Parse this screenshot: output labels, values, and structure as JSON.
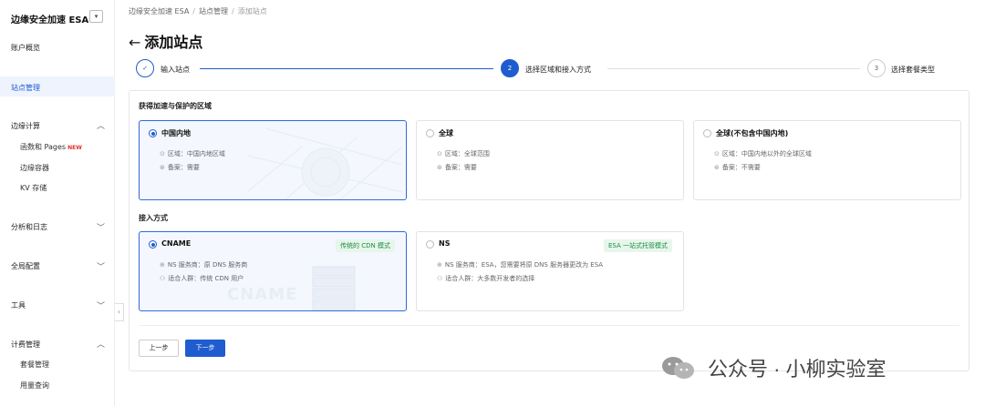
{
  "sidebar": {
    "brand": "边缘安全加速 ESA",
    "brand_toggle": "▾",
    "overview": "账户概览",
    "sites": "站点管理",
    "edge_compute": "边缘计算",
    "functions": "函数和 Pages",
    "new_badge": "NEW",
    "edge_container": "边缘容器",
    "kv": "KV 存储",
    "analytics": "分析和日志",
    "global_config": "全局配置",
    "tools": "工具",
    "billing": "计费管理",
    "plan_mgmt": "套餐管理",
    "usage": "用量查询"
  },
  "breadcrumb": {
    "root": "边缘安全加速 ESA",
    "sites": "站点管理",
    "current": "添加站点",
    "sep": "/"
  },
  "page": {
    "back_icon": "←",
    "title": "添加站点"
  },
  "steps": [
    {
      "label": "输入站点",
      "mark": "✓"
    },
    {
      "label": "选择区域和接入方式",
      "mark": "2"
    },
    {
      "label": "选择套餐类型",
      "mark": "3"
    }
  ],
  "region": {
    "title": "获得加速与保护的区域",
    "cards": [
      {
        "title": "中国内地",
        "line1": "区域：中国内地区域",
        "line2": "备案：需要"
      },
      {
        "title": "全球",
        "line1": "区域：全球范围",
        "line2": "备案：需要"
      },
      {
        "title": "全球(不包含中国内地)",
        "line1": "区域：中国内地以外的全球区域",
        "line2": "备案：不需要"
      }
    ]
  },
  "access": {
    "title": "接入方式",
    "cards": [
      {
        "title": "CNAME",
        "tag": "传统的 CDN 模式",
        "line1": "NS 服务商：原 DNS 服务商",
        "line2": "适合人群：传统 CDN 用户",
        "watermark": "CNAME"
      },
      {
        "title": "NS",
        "tag": "ESA 一站式托管模式",
        "line1": "NS 服务商：ESA，您需要将原 DNS 服务器更改为 ESA",
        "line2": "适合人群：大多数开发者的选择"
      }
    ]
  },
  "buttons": {
    "prev": "上一步",
    "next": "下一步"
  },
  "watermark": "公众号 · 小柳实验室",
  "colors": {
    "accent": "#1f5ccf",
    "tag_green": "#1e8c44"
  }
}
